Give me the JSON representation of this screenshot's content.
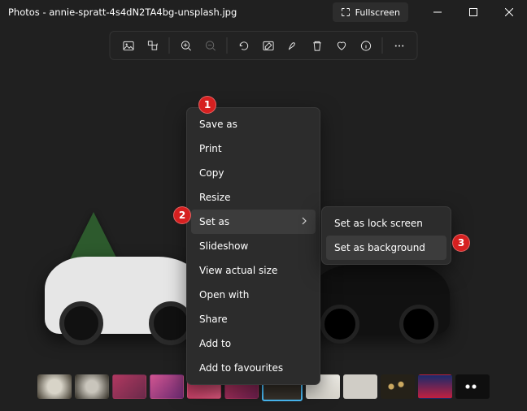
{
  "title": "Photos - annie-spratt-4s4dN2TA4bg-unsplash.jpg",
  "fullscreen_btn": "Fullscreen",
  "menu": {
    "items": [
      "Save as",
      "Print",
      "Copy",
      "Resize",
      "Set as",
      "Slideshow",
      "View actual size",
      "Open with",
      "Share",
      "Add to",
      "Add to favourites"
    ]
  },
  "submenu": {
    "items": [
      "Set as lock screen",
      "Set as background"
    ]
  },
  "callouts": {
    "c1": "1",
    "c2": "2",
    "c3": "3"
  },
  "toolbar_icons": [
    "image-compare-icon",
    "crop-icon",
    "zoom-in-icon",
    "zoom-out-icon",
    "rotate-icon",
    "edit-icon",
    "markup-icon",
    "delete-icon",
    "favourite-icon",
    "info-icon",
    "more-icon"
  ],
  "thumbnail_count": 12,
  "active_thumb_index": 6
}
